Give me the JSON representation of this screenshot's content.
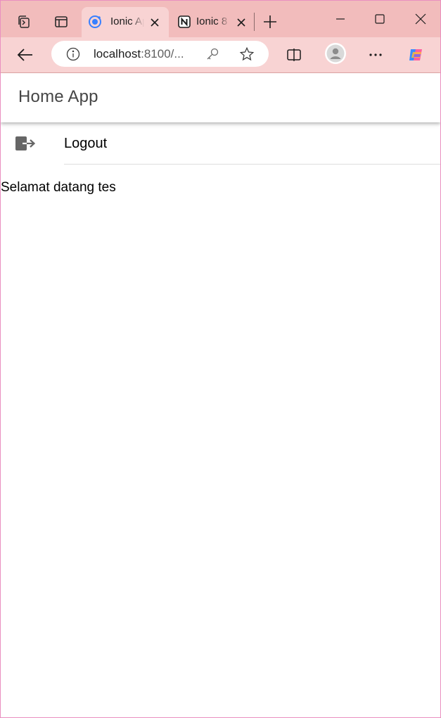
{
  "browser": {
    "tabs": [
      {
        "title": "Ionic App",
        "favicon": "ionic-logo-icon",
        "active": true
      },
      {
        "title": "Ionic 8",
        "favicon": "notion-logo-icon",
        "active": false
      }
    ],
    "address": {
      "host": "localhost",
      "rest": ":8100/..."
    },
    "colors": {
      "tabstrip": "#f2bcbc",
      "toolbar": "#f8d3d3",
      "frame": "#e98fc0"
    }
  },
  "app": {
    "header_title": "Home App",
    "menu": [
      {
        "label": "Logout",
        "icon": "logout-icon"
      }
    ],
    "welcome_text": "Selamat datang tes"
  }
}
